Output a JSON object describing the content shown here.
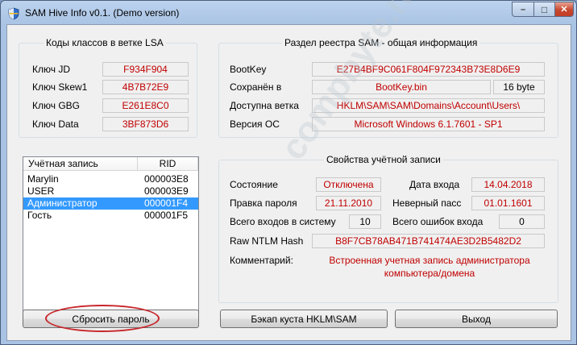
{
  "window": {
    "title": "SAM Hive Info v0.1. (Demo version)",
    "icon": "shield-app-icon",
    "controls": {
      "minimize": "–",
      "maximize": "□",
      "close": "✕"
    }
  },
  "lsa": {
    "title": "Коды классов в ветке LSA",
    "rows": [
      {
        "label": "Ключ JD",
        "value": "F934F904"
      },
      {
        "label": "Ключ Skew1",
        "value": "4B7B72E9"
      },
      {
        "label": "Ключ GBG",
        "value": "E261E8C0"
      },
      {
        "label": "Ключ Data",
        "value": "3BF873D6"
      }
    ]
  },
  "sam": {
    "title": "Раздел реестра SAM - общая информация",
    "bootkey_label": "BootKey",
    "bootkey_value": "E27B4BF9C061F804F972343B73E8D6E9",
    "saved_label": "Сохранён в",
    "saved_file": "BootKey.bin",
    "saved_size": "16 byte",
    "branch_label": "Доступна ветка",
    "branch_value": "HKLM\\SAM\\SAM\\Domains\\Account\\Users\\",
    "os_label": "Версия ОС",
    "os_value": "Microsoft Windows 6.1.7601 - SP1"
  },
  "accounts": {
    "col_account": "Учётная запись",
    "col_rid": "RID",
    "rows": [
      {
        "name": "Marylin",
        "rid": "000003E8"
      },
      {
        "name": "USER",
        "rid": "000003E9"
      },
      {
        "name": "Администратор",
        "rid": "000001F4"
      },
      {
        "name": "Гость",
        "rid": "000001F5"
      }
    ],
    "selected_index": 2
  },
  "props": {
    "title": "Свойства учётной записи",
    "state_label": "Состояние",
    "state_value": "Отключена",
    "login_date_label": "Дата входа",
    "login_date_value": "14.04.2018",
    "pwd_change_label": "Правка пароля",
    "pwd_change_value": "21.11.2010",
    "bad_pwd_label": "Неверный пасс",
    "bad_pwd_value": "01.01.1601",
    "logins_label": "Всего входов в систему",
    "logins_value": "10",
    "errors_label": "Всего ошибок входа",
    "errors_value": "0",
    "ntlm_label": "Raw NTLM Hash",
    "ntlm_value": "B8F7CB78AB471B741474AE3D2B5482D2",
    "comment_label": "Комментарий:",
    "comment_value": "Встроенная учетная запись администратора компьютера/домена"
  },
  "buttons": {
    "reset": "Сбросить пароль",
    "backup": "Бэкап куста HKLM\\SAM",
    "exit": "Выход"
  },
  "watermark": "compbyte.net",
  "colors": {
    "value_text": "#c00000",
    "selection": "#3399ff",
    "highlight_oval": "#c8262b"
  }
}
